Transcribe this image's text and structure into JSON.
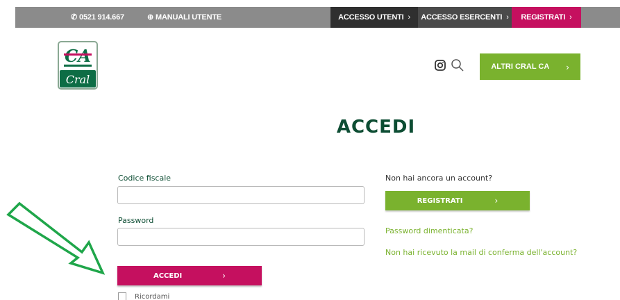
{
  "topbar": {
    "phone": "0521 914.667",
    "manuals": "MANUALI UTENTE",
    "accesso_utenti": "ACCESSO UTENTI",
    "accesso_esercenti": "ACCESSO ESERCENTI",
    "registrati": "REGISTRATI",
    "chevron": "›"
  },
  "header": {
    "logo_text_top": "CA",
    "logo_text_bottom": "Cral",
    "altri_label": "ALTRI CRAL CA",
    "chevron": "›"
  },
  "main": {
    "title": "ACCEDI",
    "codice_label": "Codice fiscale",
    "codice_value": "",
    "password_label": "Password",
    "password_value": "",
    "submit_label": "ACCEDI",
    "remember_label": "Ricordami",
    "chevron": "›"
  },
  "side": {
    "no_account": "Non hai ancora un account?",
    "register_label": "REGISTRATI",
    "forgot_link": "Password dimenticata?",
    "no_mail_link": "Non hai ricevuto la mail di conferma dell'account?",
    "chevron": "›"
  },
  "colors": {
    "topbar": "#8b8b8b",
    "brand_magenta": "#c5105f",
    "brand_green": "#7ab22e",
    "title_green": "#0d4d33",
    "annotation_arrow": "#1fa64a"
  },
  "icons": [
    "phone-icon",
    "lifebuoy-icon",
    "instagram-icon",
    "search-icon",
    "chevron-right-icon",
    "arrow-annotation"
  ]
}
